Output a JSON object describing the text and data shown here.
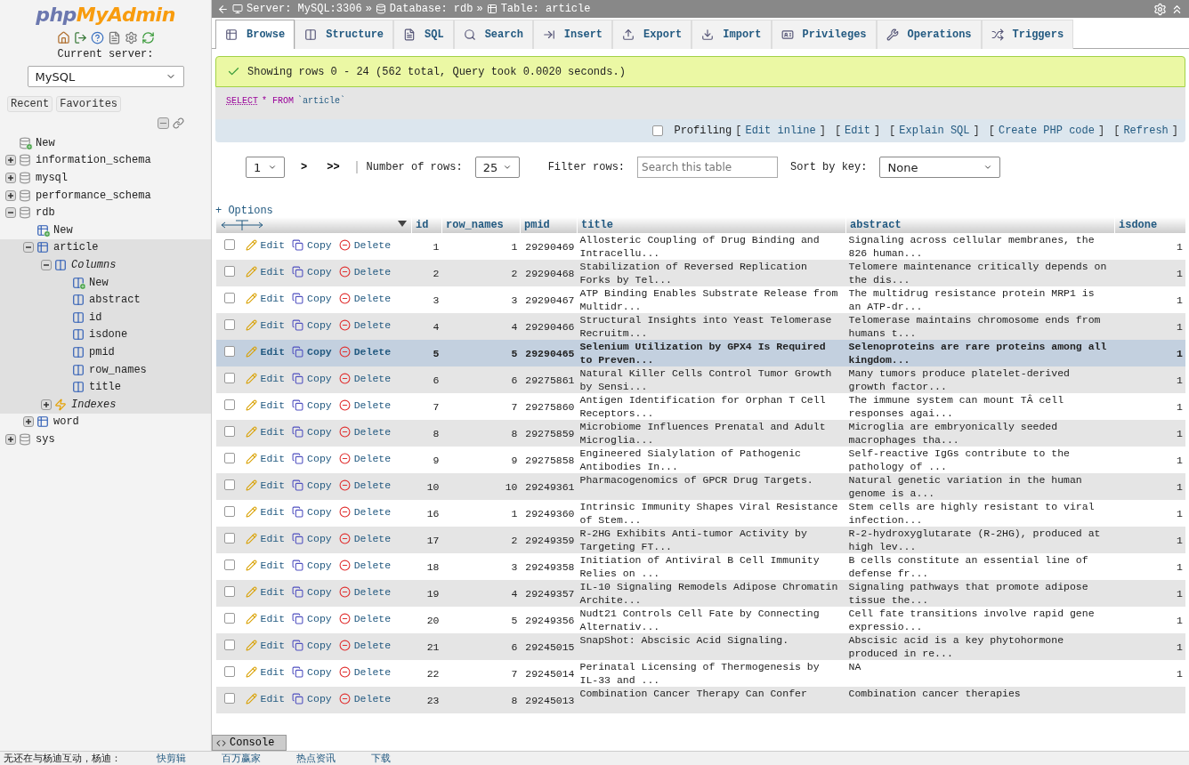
{
  "sidebar": {
    "logo": {
      "part1": "php",
      "part2": "MyAdmin"
    },
    "current_server_label": "Current server:",
    "server_select": "MySQL",
    "tabs": [
      {
        "label": "Recent",
        "selected": false
      },
      {
        "label": "Favorites",
        "selected": false
      }
    ],
    "tree": [
      {
        "label": "New",
        "kind": "new-db"
      },
      {
        "label": "information_schema",
        "kind": "db",
        "expanded": false
      },
      {
        "label": "mysql",
        "kind": "db",
        "expanded": false
      },
      {
        "label": "performance_schema",
        "kind": "db",
        "expanded": false
      },
      {
        "label": "rdb",
        "kind": "db",
        "expanded": true,
        "children": [
          {
            "label": "New",
            "kind": "new-table",
            "selected": false
          },
          {
            "label": "article",
            "kind": "table",
            "expanded": true,
            "selected": true,
            "children": [
              {
                "label": "Columns",
                "kind": "group",
                "expanded": true,
                "children": [
                  {
                    "label": "New",
                    "kind": "new-column"
                  },
                  {
                    "label": "abstract",
                    "kind": "column"
                  },
                  {
                    "label": "id",
                    "kind": "column"
                  },
                  {
                    "label": "isdone",
                    "kind": "column"
                  },
                  {
                    "label": "pmid",
                    "kind": "column"
                  },
                  {
                    "label": "row_names",
                    "kind": "column"
                  },
                  {
                    "label": "title",
                    "kind": "column"
                  }
                ]
              },
              {
                "label": "Indexes",
                "kind": "indexes",
                "expanded": false
              }
            ]
          },
          {
            "label": "word",
            "kind": "table",
            "expanded": false,
            "selected": false
          }
        ]
      },
      {
        "label": "sys",
        "kind": "db",
        "expanded": false
      }
    ]
  },
  "breadcrumb": [
    {
      "label": "Server: MySQL:3306",
      "kind": "server"
    },
    {
      "sep": "»",
      "label": "Database: rdb",
      "kind": "database"
    },
    {
      "sep": "»",
      "label": "Table: article",
      "kind": "table"
    }
  ],
  "tabs": [
    {
      "label": "Browse",
      "kind": "browse",
      "selected": true
    },
    {
      "label": "Structure",
      "kind": "structure",
      "selected": false
    },
    {
      "label": "SQL",
      "kind": "sql",
      "selected": false
    },
    {
      "label": "Search",
      "kind": "search",
      "selected": false
    },
    {
      "label": "Insert",
      "kind": "insert",
      "selected": false
    },
    {
      "label": "Export",
      "kind": "export",
      "selected": false
    },
    {
      "label": "Import",
      "kind": "import",
      "selected": false
    },
    {
      "label": "Privileges",
      "kind": "privileges",
      "selected": false
    },
    {
      "label": "Operations",
      "kind": "operations",
      "selected": false
    },
    {
      "label": "Triggers",
      "kind": "triggers",
      "selected": false
    }
  ],
  "message": "Showing rows 0 - 24 (562 total, Query took 0.0020 seconds.)",
  "query": {
    "keyword1": "SELECT",
    "rest": "* FROM",
    "table": "`article`"
  },
  "profiling": {
    "label": "Profiling",
    "checked": false,
    "links": [
      {
        "open": "[",
        "label": "Edit inline",
        "close": "]"
      },
      {
        "open": "[",
        "label": "Edit",
        "close": "]"
      },
      {
        "open": "[",
        "label": "Explain SQL",
        "close": "]"
      },
      {
        "open": "[",
        "label": "Create PHP code",
        "close": "]"
      },
      {
        "open": "[",
        "label": "Refresh",
        "close": "]"
      }
    ]
  },
  "navigation": {
    "page": "1",
    "next": ">",
    "last": ">>",
    "rows_label": "Number of rows:",
    "rows": "25",
    "filter_label": "Filter rows:",
    "filter_placeholder": "Search this table",
    "sort_label": "Sort by key:",
    "sort": "None"
  },
  "options_link": "+ Options",
  "table": {
    "columns": [
      "id",
      "row_names",
      "pmid",
      "title",
      "abstract",
      "isdone"
    ],
    "rows": [
      {
        "checked": false,
        "selected": false,
        "actions": [
          "Edit",
          "Copy",
          "Delete"
        ],
        "cells": [
          "1",
          "1",
          "29290469",
          "Allosteric Coupling of Drug Binding and Intracellu...",
          "Signaling across cellular membranes, the 826 human...",
          "1"
        ]
      },
      {
        "checked": false,
        "selected": false,
        "actions": [
          "Edit",
          "Copy",
          "Delete"
        ],
        "cells": [
          "2",
          "2",
          "29290468",
          "Stabilization of Reversed Replication Forks by Tel...",
          "Telomere maintenance critically depends on the dis...",
          "1"
        ]
      },
      {
        "checked": false,
        "selected": false,
        "actions": [
          "Edit",
          "Copy",
          "Delete"
        ],
        "cells": [
          "3",
          "3",
          "29290467",
          "ATP Binding Enables Substrate Release from Multidr...",
          "The multidrug resistance protein MRP1 is an ATP-dr...",
          "1"
        ]
      },
      {
        "checked": false,
        "selected": false,
        "actions": [
          "Edit",
          "Copy",
          "Delete"
        ],
        "cells": [
          "4",
          "4",
          "29290466",
          "Structural Insights into Yeast Telomerase Recruitm...",
          "Telomerase maintains chromosome ends from humans t...",
          "1"
        ]
      },
      {
        "checked": false,
        "selected": true,
        "actions": [
          "Edit",
          "Copy",
          "Delete"
        ],
        "cells": [
          "5",
          "5",
          "29290465",
          "Selenium Utilization by GPX4 Is Required to Preven...",
          "Selenoproteins are rare proteins among all kingdom...",
          "1"
        ]
      },
      {
        "checked": false,
        "selected": false,
        "actions": [
          "Edit",
          "Copy",
          "Delete"
        ],
        "cells": [
          "6",
          "6",
          "29275861",
          "Natural Killer Cells Control Tumor Growth by Sensi...",
          "Many tumors produce platelet-derived growth factor...",
          "1"
        ]
      },
      {
        "checked": false,
        "selected": false,
        "actions": [
          "Edit",
          "Copy",
          "Delete"
        ],
        "cells": [
          "7",
          "7",
          "29275860",
          "Antigen Identification for Orphan T Cell Receptors...",
          "The immune system can mount TÂ cell responses agai...",
          "1"
        ]
      },
      {
        "checked": false,
        "selected": false,
        "actions": [
          "Edit",
          "Copy",
          "Delete"
        ],
        "cells": [
          "8",
          "8",
          "29275859",
          "Microbiome Influences Prenatal and Adult Microglia...",
          "Microglia are embryonically seeded macrophages tha...",
          "1"
        ]
      },
      {
        "checked": false,
        "selected": false,
        "actions": [
          "Edit",
          "Copy",
          "Delete"
        ],
        "cells": [
          "9",
          "9",
          "29275858",
          "Engineered Sialylation of Pathogenic Antibodies In...",
          "Self-reactive IgGs contribute to the pathology of ...",
          "1"
        ]
      },
      {
        "checked": false,
        "selected": false,
        "actions": [
          "Edit",
          "Copy",
          "Delete"
        ],
        "cells": [
          "10",
          "10",
          "29249361",
          "Pharmacogenomics of GPCR Drug Targets.",
          "Natural genetic variation in the human genome is a...",
          "1"
        ]
      },
      {
        "checked": false,
        "selected": false,
        "actions": [
          "Edit",
          "Copy",
          "Delete"
        ],
        "cells": [
          "16",
          "1",
          "29249360",
          "Intrinsic Immunity Shapes Viral Resistance of Stem...",
          "Stem cells are highly resistant to viral infection...",
          "1"
        ]
      },
      {
        "checked": false,
        "selected": false,
        "actions": [
          "Edit",
          "Copy",
          "Delete"
        ],
        "cells": [
          "17",
          "2",
          "29249359",
          "R-2HG Exhibits Anti-tumor Activity by Targeting FT...",
          "R-2-hydroxyglutarate (R-2HG), produced at high lev...",
          "1"
        ]
      },
      {
        "checked": false,
        "selected": false,
        "actions": [
          "Edit",
          "Copy",
          "Delete"
        ],
        "cells": [
          "18",
          "3",
          "29249358",
          "Initiation of Antiviral B Cell Immunity Relies on ...",
          "B cells constitute an essential line of defense fr...",
          "1"
        ]
      },
      {
        "checked": false,
        "selected": false,
        "actions": [
          "Edit",
          "Copy",
          "Delete"
        ],
        "cells": [
          "19",
          "4",
          "29249357",
          "IL-10 Signaling Remodels Adipose Chromatin Archite...",
          "Signaling pathways that promote adipose tissue the...",
          "1"
        ]
      },
      {
        "checked": false,
        "selected": false,
        "actions": [
          "Edit",
          "Copy",
          "Delete"
        ],
        "cells": [
          "20",
          "5",
          "29249356",
          "Nudt21 Controls Cell Fate by Connecting Alternativ...",
          "Cell fate transitions involve rapid gene expressio...",
          "1"
        ]
      },
      {
        "checked": false,
        "selected": false,
        "actions": [
          "Edit",
          "Copy",
          "Delete"
        ],
        "cells": [
          "21",
          "6",
          "29245015",
          "SnapShot: Abscisic Acid Signaling.",
          "Abscisic acid is a key phytohormone produced in re...",
          "1"
        ]
      },
      {
        "checked": false,
        "selected": false,
        "actions": [
          "Edit",
          "Copy",
          "Delete"
        ],
        "cells": [
          "22",
          "7",
          "29245014",
          "Perinatal Licensing of Thermogenesis by IL-33 and ...",
          "NA",
          "1"
        ]
      },
      {
        "checked": false,
        "selected": false,
        "actions": [
          "Edit",
          "Copy",
          "Delete"
        ],
        "cells": [
          "23",
          "8",
          "29245013",
          "Combination Cancer Therapy Can Confer",
          "Combination cancer therapies",
          ""
        ]
      }
    ]
  },
  "console": "Console",
  "status_bar": {
    "text": "无还在与杨迪互动，杨迪：",
    "items": [
      "快剪辑",
      "百万赢家",
      "热点资讯",
      "下载"
    ]
  }
}
